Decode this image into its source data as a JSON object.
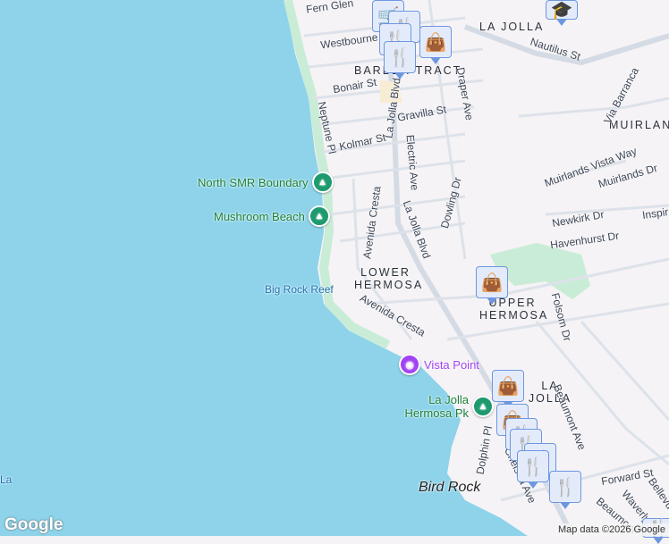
{
  "map": {
    "areas": [
      "LA JOLLA",
      "BARBER TRACT",
      "MUIRLANDS",
      "LOWER HERMOSA",
      "UPPER HERMOSA",
      "LA JOLLA HERMOSA"
    ],
    "streets": [
      "Fern Glen",
      "Westbourne St",
      "Nautilus St",
      "Bonair St",
      "Draper Ave",
      "Neptune Pl",
      "Gravilla St",
      "La Jolla Blvd",
      "Kolmar St",
      "Electric Ave",
      "Via Barranca",
      "Muirlands Vista Way",
      "Muirlands Dr",
      "Dowling Dr",
      "Avenida Cresta",
      "La Jolla Blvd",
      "Newkirk Dr",
      "Havenhurst Dr",
      "Inspiration",
      "Folsom Dr",
      "Avenida Cresta",
      "Beaumont Ave",
      "Dolphin Pl",
      "Chelsea Ave",
      "Forward St",
      "Bellevue",
      "Waverly",
      "Beaumont"
    ],
    "parks": [
      "North SMR Boundary",
      "Mushroom Beach",
      "La Jolla Hermosa Pk"
    ],
    "poi": {
      "vista": "Vista Point",
      "reef": "Big Rock Reef",
      "bird_rock": "Bird Rock",
      "bottom_left": "La Jolla"
    },
    "logo": "Google",
    "attribution": "Map data ©2026 Google",
    "colors": {
      "water": "#8ed3ea",
      "land": "#f5f3f5",
      "park": "#c9ecd6",
      "poi_purple": "#a142f4"
    }
  }
}
